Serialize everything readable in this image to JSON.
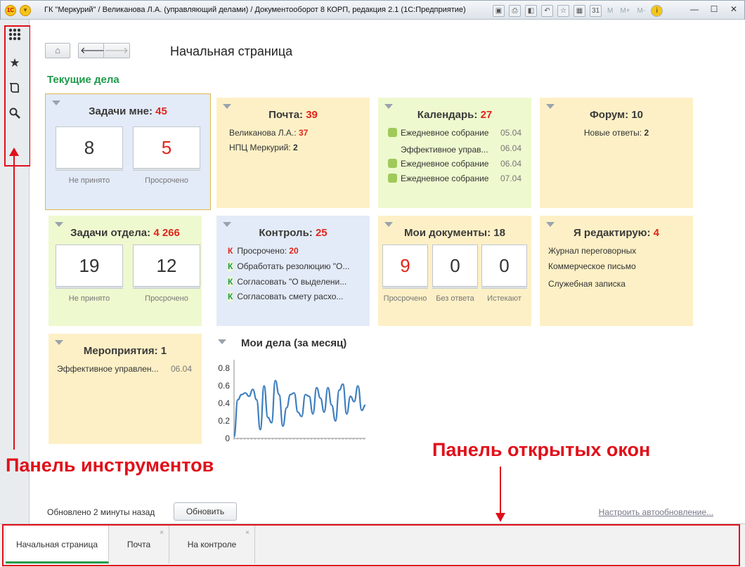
{
  "window": {
    "title": "ГК \"Меркурий\" / Великанова Л.А. (управляющий делами) / Документооборот 8 КОРП, редакция 2.1  (1С:Предприятие)",
    "logo": "1C",
    "tools": [
      "save-icon",
      "print-icon",
      "preview-icon",
      "back-icon",
      "favorite-icon",
      "calculator-icon",
      "calendar-icon"
    ],
    "mem_buttons": [
      "M",
      "M+",
      "M-"
    ]
  },
  "toolbar_panel": {
    "icons": [
      "apps-grid-icon",
      "star-icon",
      "history-icon",
      "search-icon"
    ]
  },
  "header": {
    "page_title": "Начальная страница",
    "section_title": "Текущие дела"
  },
  "tiles": {
    "tasks_me": {
      "title": "Задачи мне:",
      "count": "45",
      "c1": "8",
      "c1_label": "Не принято",
      "c2": "5",
      "c2_label": "Просрочено"
    },
    "mail": {
      "title": "Почта:",
      "count": "39",
      "lines": [
        {
          "name": "Великанова Л.А.:",
          "num": "37"
        },
        {
          "name": "НПЦ Меркурий:",
          "num": "2"
        }
      ]
    },
    "calendar": {
      "title": "Календарь:",
      "count": "27",
      "items": [
        {
          "text": "Ежедневное собрание",
          "date": "05.04",
          "dot": true
        },
        {
          "text": "Эффективное управ...",
          "date": "06.04",
          "dot": false
        },
        {
          "text": "Ежедневное собрание",
          "date": "06.04",
          "dot": true
        },
        {
          "text": "Ежедневное собрание",
          "date": "07.04",
          "dot": true
        }
      ]
    },
    "forum": {
      "title": "Форум: 10",
      "line": "Новые ответы:",
      "num": "2"
    },
    "tasks_dept": {
      "title": "Задачи отдела:",
      "count": "4 266",
      "c1": "19",
      "c1_label": "Не принято",
      "c2": "12",
      "c2_label": "Просрочено"
    },
    "control": {
      "title": "Контроль:",
      "count": "25",
      "items": [
        {
          "mark": "К",
          "text": "Просрочено:",
          "num": "20"
        },
        {
          "mark": "К",
          "text": "Обработать резолюцию \"О...",
          "num": ""
        },
        {
          "mark": "К",
          "text": "Согласовать \"О выделени...",
          "num": ""
        },
        {
          "mark": "К",
          "text": "Согласовать смету расхо...",
          "num": ""
        }
      ]
    },
    "my_docs": {
      "title": "Мои документы: 18",
      "c1": "9",
      "c1_label": "Просрочено",
      "c2": "0",
      "c2_label": "Без ответа",
      "c3": "0",
      "c3_label": "Истекают"
    },
    "editing": {
      "title": "Я редактирую:",
      "count": "4",
      "items": [
        "Журнал переговорных",
        "Коммерческое письмо",
        "Служебная записка"
      ]
    },
    "events": {
      "title": "Мероприятия: 1",
      "item": "Эффективное управлен...",
      "date": "06.04"
    }
  },
  "chart_data": {
    "type": "line",
    "title": "Мои дела (за месяц)",
    "y_ticks": [
      "0.8",
      "0.6",
      "0.4",
      "0.2",
      "0"
    ],
    "ylim": [
      0,
      0.85
    ],
    "grid": false,
    "series": [
      {
        "color": "#3f7fbf",
        "values": [
          0.02,
          0.44,
          0.5,
          0.52,
          0.48,
          0.56,
          0.44,
          0.1,
          0.6,
          0.24,
          0.18,
          0.66,
          0.5,
          0.14,
          0.35,
          0.5,
          0.52,
          0.3,
          0.25,
          0.5,
          0.48,
          0.28,
          0.58,
          0.46,
          0.3,
          0.58,
          0.38,
          0.2,
          0.55,
          0.62,
          0.28,
          0.48,
          0.42,
          0.6,
          0.32,
          0.38
        ]
      }
    ]
  },
  "footer": {
    "updated_text": "Обновлено 2 минуты назад",
    "refresh_label": "Обновить",
    "autoupdate_link": "Настроить автообновление..."
  },
  "annotations": {
    "left": "Панель инструментов",
    "right": "Панель открытых окон"
  },
  "tabs": [
    {
      "label": "Начальная страница",
      "active": true
    },
    {
      "label": "Почта",
      "active": false
    },
    {
      "label": "На контроле",
      "active": false
    }
  ],
  "colors": {
    "accent_green": "#1d9a4a",
    "alert_red": "#e0251b",
    "annotation_red": "#e0101a"
  }
}
